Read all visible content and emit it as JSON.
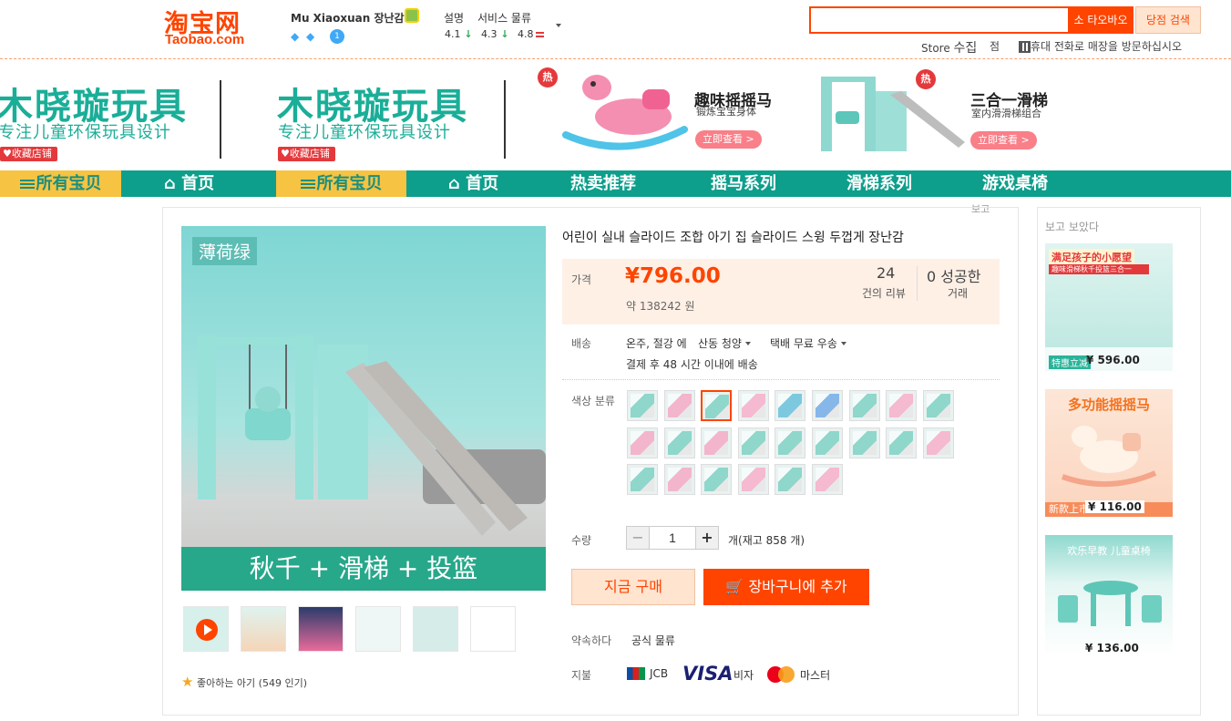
{
  "header": {
    "logo_cn": "淘宝网",
    "logo_en": "Taobao.com",
    "shop_name": "Mu Xiaoxuan 장난감",
    "level_badge": "1",
    "ratings": {
      "desc_label": "설명",
      "desc_value": "4.1",
      "service_label": "서비스 물류",
      "service_value": "4.3",
      "logistics_value": "4.8"
    },
    "search": {
      "placeholder": "",
      "btn_taobao": "소 타오바오",
      "btn_shop": "당점 검색"
    },
    "store_label": "Store",
    "collect_label": "수집",
    "shop_char": "점",
    "mobile_text": "휴대 전화로 매장을 방문하십시오"
  },
  "banner": {
    "brand_title": "木晓璇玩具",
    "brand_sub": "专注儿童环保玩具设计",
    "fav_label": "收藏店铺",
    "hot_label": "热",
    "promo1": {
      "title": "趣味摇摇马",
      "sub": "锻炼宝宝身体",
      "btn": "立即查看 >"
    },
    "promo2": {
      "title": "三合一滑梯",
      "sub": "室内滑滑梯组合",
      "btn": "立即查看 >"
    }
  },
  "nav": {
    "all": "所有宝贝",
    "home": "首页",
    "items": [
      "热卖推荐",
      "摇马系列",
      "滑梯系列",
      "游戏桌椅"
    ]
  },
  "report_label": "보고",
  "product": {
    "image_tag": "薄荷绿",
    "image_caption": "秋千 + 滑梯 + 投篮",
    "title": "어린이 실내 슬라이드 조합 아기 집 슬라이드 스윙 두껍게 장난감",
    "price_label": "가격",
    "price": "¥796.00",
    "price_approx": "약 138242 원",
    "reviews_count": "24",
    "reviews_label": "건의 리뷰",
    "deals_count": "0",
    "deals_suffix": "성공한",
    "deals_label": "거래",
    "shipping_label": "배송",
    "shipping_from": "온주, 절강 에",
    "shipping_to": "산동 청양",
    "shipping_method": "택배 무료 우송",
    "shipping_time": "결제 후 48 시간 이내에 배송",
    "color_label": "색상 분류",
    "qty_label": "수량",
    "qty_minus": "−",
    "qty_value": "1",
    "qty_plus": "+",
    "stock": "개(재고 858 개)",
    "buy_now": "지금 구매",
    "add_cart": "장바구니에 추가",
    "promise_label": "약속하다",
    "promise_value": "공식 물류",
    "payment_label": "지불",
    "pay_jcb": "JCB",
    "pay_visa_logo": "VISA",
    "pay_visa": "비자",
    "pay_master": "마스터",
    "likes": "좋아하는 아기 (549 인기)"
  },
  "sidebar": {
    "title": "보고 보았다",
    "items": [
      {
        "price": "¥ 596.00",
        "caption": "满足孩子的小愿望",
        "sub": "趣味滑梯秋千投篮三合一",
        "tag": "特惠立减"
      },
      {
        "price": "¥ 116.00",
        "caption": "多功能摇摇马",
        "tag": "新款上市"
      },
      {
        "price": "¥ 136.00",
        "caption": "欢乐早教 儿童桌椅"
      }
    ]
  },
  "colors": {
    "accent": "#ff4400",
    "teal": "#0d9f8c",
    "yellow": "#f6c342",
    "hot": "#e4393c"
  }
}
